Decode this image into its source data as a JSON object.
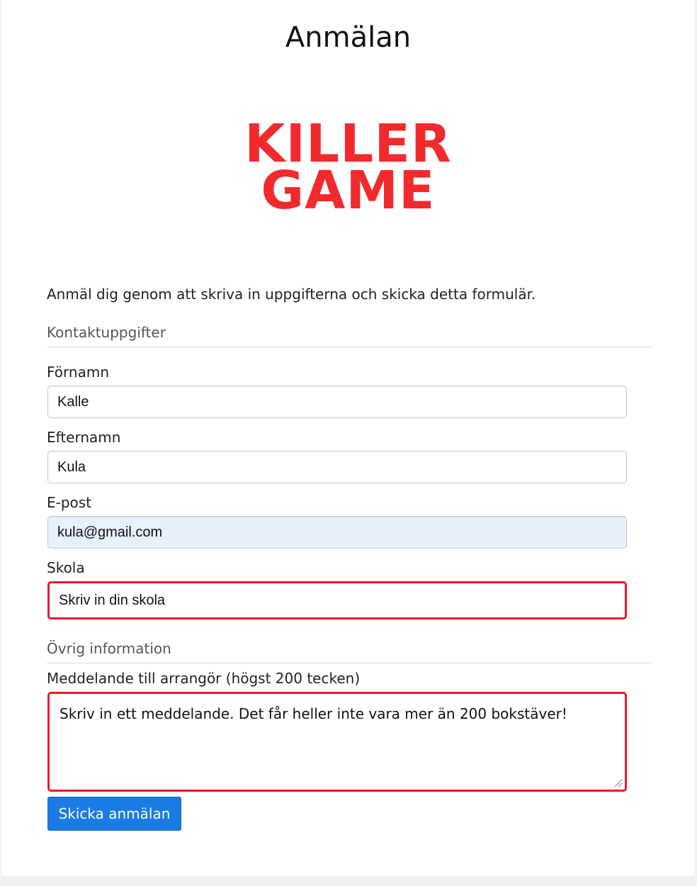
{
  "page": {
    "title": "Anmälan",
    "logo_line1": "KILLER",
    "logo_line2": "GAME",
    "intro": "Anmäl dig genom att skriva in uppgifterna och skicka detta formulär."
  },
  "contact": {
    "legend": "Kontaktuppgifter",
    "first_name": {
      "label": "Förnamn",
      "value": "Kalle"
    },
    "last_name": {
      "label": "Efternamn",
      "value": "Kula"
    },
    "email": {
      "label": "E-post",
      "value": "kula@gmail.com"
    },
    "school": {
      "label": "Skola",
      "value": "Skriv in din skola"
    }
  },
  "other": {
    "legend": "Övrig information",
    "message": {
      "label": "Meddelande till arrangör (högst 200 tecken)",
      "value": "Skriv in ett meddelande. Det får heller inte vara mer än 200 bokstäver!"
    }
  },
  "submit_label": "Skicka anmälan",
  "colors": {
    "logo": "#f22a2e",
    "invalid_border": "#ea1a2c",
    "autofill_bg": "#e8f0fe",
    "button": "#1a7be2"
  }
}
